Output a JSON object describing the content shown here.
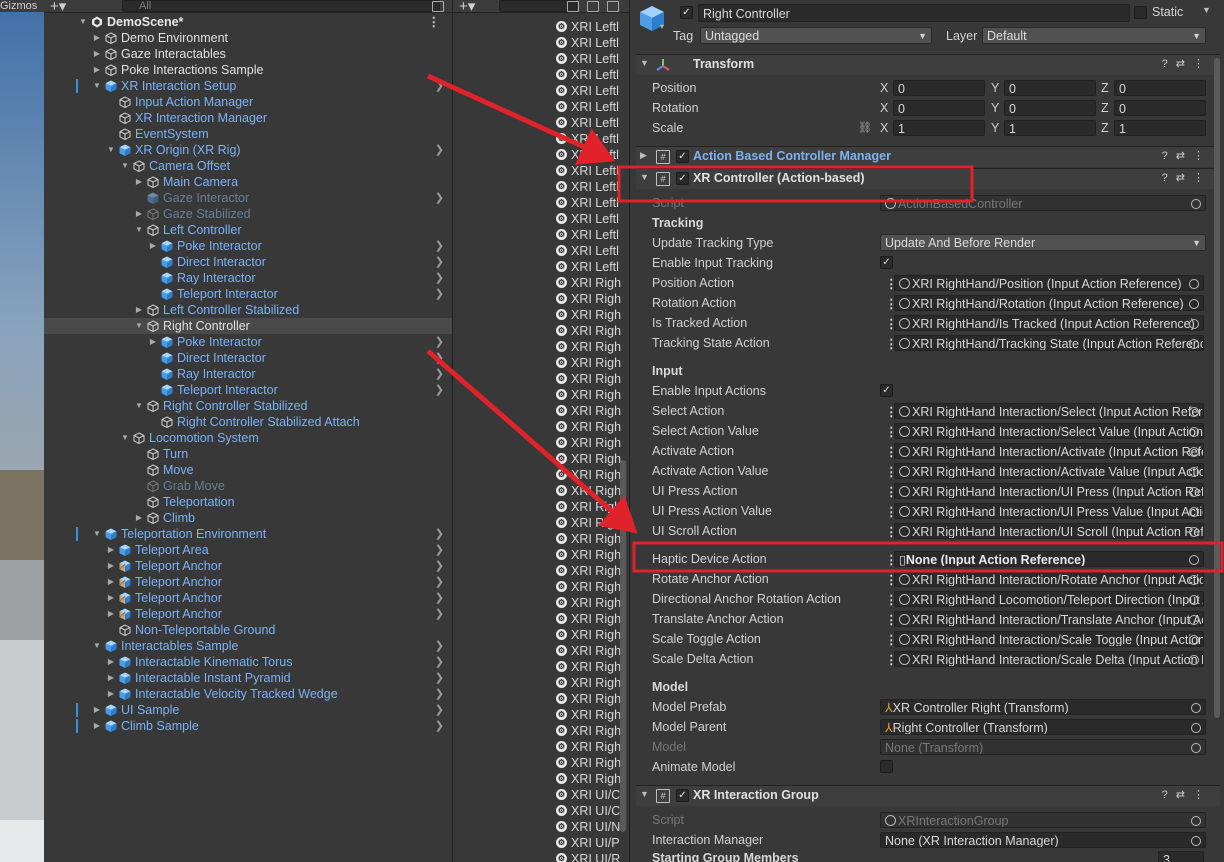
{
  "scene": {
    "gizmos_label": "Gizmos"
  },
  "hierarchy": {
    "search_placeholder": "All",
    "items": [
      {
        "label": "DemoScene*",
        "indent": 0,
        "style": "bold",
        "arrow": "down",
        "icon": "unity",
        "kebab": true
      },
      {
        "label": "Demo Environment",
        "indent": 1,
        "style": "white",
        "arrow": "right",
        "icon": "cube"
      },
      {
        "label": "Gaze Interactables",
        "indent": 1,
        "style": "white",
        "arrow": "right",
        "icon": "cube"
      },
      {
        "label": "Poke Interactions Sample",
        "indent": 1,
        "style": "white",
        "arrow": "right",
        "icon": "cube"
      },
      {
        "label": "XR Interaction Setup",
        "indent": 1,
        "style": "blue",
        "arrow": "down",
        "icon": "prefab",
        "chev": true,
        "mark": true
      },
      {
        "label": "Input Action Manager",
        "indent": 2,
        "style": "blue",
        "arrow": "none",
        "icon": "cube"
      },
      {
        "label": "XR Interaction Manager",
        "indent": 2,
        "style": "blue",
        "arrow": "none",
        "icon": "cube"
      },
      {
        "label": "EventSystem",
        "indent": 2,
        "style": "blue",
        "arrow": "none",
        "icon": "cube"
      },
      {
        "label": "XR Origin (XR Rig)",
        "indent": 2,
        "style": "blue",
        "arrow": "down",
        "icon": "prefab",
        "chev": true
      },
      {
        "label": "Camera Offset",
        "indent": 3,
        "style": "blue",
        "arrow": "down",
        "icon": "cube"
      },
      {
        "label": "Main Camera",
        "indent": 4,
        "style": "blue",
        "arrow": "right",
        "icon": "cube"
      },
      {
        "label": "Gaze Interactor",
        "indent": 4,
        "style": "dim",
        "arrow": "none",
        "icon": "prefab-dim",
        "chev": true
      },
      {
        "label": "Gaze Stabilized",
        "indent": 4,
        "style": "dim",
        "arrow": "right",
        "icon": "cube-dim"
      },
      {
        "label": "Left Controller",
        "indent": 4,
        "style": "blue",
        "arrow": "down",
        "icon": "cube"
      },
      {
        "label": "Poke Interactor",
        "indent": 5,
        "style": "blue",
        "arrow": "right",
        "icon": "prefab",
        "chev": true
      },
      {
        "label": "Direct Interactor",
        "indent": 5,
        "style": "blue",
        "arrow": "none",
        "icon": "prefab",
        "chev": true
      },
      {
        "label": "Ray Interactor",
        "indent": 5,
        "style": "blue",
        "arrow": "none",
        "icon": "prefab",
        "chev": true
      },
      {
        "label": "Teleport Interactor",
        "indent": 5,
        "style": "blue",
        "arrow": "none",
        "icon": "prefab",
        "chev": true
      },
      {
        "label": "Left Controller Stabilized",
        "indent": 4,
        "style": "blue",
        "arrow": "right",
        "icon": "cube"
      },
      {
        "label": "Right Controller",
        "indent": 4,
        "style": "white",
        "arrow": "down",
        "icon": "cube",
        "selected": true
      },
      {
        "label": "Poke Interactor",
        "indent": 5,
        "style": "blue",
        "arrow": "right",
        "icon": "prefab",
        "chev": true
      },
      {
        "label": "Direct Interactor",
        "indent": 5,
        "style": "blue",
        "arrow": "none",
        "icon": "prefab",
        "chev": true
      },
      {
        "label": "Ray Interactor",
        "indent": 5,
        "style": "blue",
        "arrow": "none",
        "icon": "prefab",
        "chev": true
      },
      {
        "label": "Teleport Interactor",
        "indent": 5,
        "style": "blue",
        "arrow": "none",
        "icon": "prefab",
        "chev": true
      },
      {
        "label": "Right Controller Stabilized",
        "indent": 4,
        "style": "blue",
        "arrow": "down",
        "icon": "cube"
      },
      {
        "label": "Right Controller Stabilized Attach",
        "indent": 5,
        "style": "blue",
        "arrow": "none",
        "icon": "cube"
      },
      {
        "label": "Locomotion System",
        "indent": 3,
        "style": "blue",
        "arrow": "down",
        "icon": "cube"
      },
      {
        "label": "Turn",
        "indent": 4,
        "style": "blue",
        "arrow": "none",
        "icon": "cube"
      },
      {
        "label": "Move",
        "indent": 4,
        "style": "blue",
        "arrow": "none",
        "icon": "cube"
      },
      {
        "label": "Grab Move",
        "indent": 4,
        "style": "dim",
        "arrow": "none",
        "icon": "cube-dim"
      },
      {
        "label": "Teleportation",
        "indent": 4,
        "style": "blue",
        "arrow": "none",
        "icon": "cube"
      },
      {
        "label": "Climb",
        "indent": 4,
        "style": "blue",
        "arrow": "right",
        "icon": "cube"
      },
      {
        "label": "Teleportation Environment",
        "indent": 1,
        "style": "blue",
        "arrow": "down",
        "icon": "prefab",
        "chev": true,
        "mark": true
      },
      {
        "label": "Teleport Area",
        "indent": 2,
        "style": "blue",
        "arrow": "right",
        "icon": "prefab",
        "chev": true
      },
      {
        "label": "Teleport Anchor",
        "indent": 2,
        "style": "blue",
        "arrow": "right",
        "icon": "prefab-stripe",
        "chev": true
      },
      {
        "label": "Teleport Anchor",
        "indent": 2,
        "style": "blue",
        "arrow": "right",
        "icon": "prefab-stripe",
        "chev": true
      },
      {
        "label": "Teleport Anchor",
        "indent": 2,
        "style": "blue",
        "arrow": "right",
        "icon": "prefab-stripe",
        "chev": true
      },
      {
        "label": "Teleport Anchor",
        "indent": 2,
        "style": "blue",
        "arrow": "right",
        "icon": "prefab-stripe",
        "chev": true
      },
      {
        "label": "Non-Teleportable Ground",
        "indent": 2,
        "style": "blue",
        "arrow": "none",
        "icon": "cube"
      },
      {
        "label": "Interactables Sample",
        "indent": 1,
        "style": "blue",
        "arrow": "down",
        "icon": "prefab",
        "chev": true
      },
      {
        "label": "Interactable Kinematic Torus",
        "indent": 2,
        "style": "blue",
        "arrow": "right",
        "icon": "prefab",
        "chev": true
      },
      {
        "label": "Interactable Instant Pyramid",
        "indent": 2,
        "style": "blue",
        "arrow": "right",
        "icon": "prefab",
        "chev": true
      },
      {
        "label": "Interactable Velocity Tracked Wedge",
        "indent": 2,
        "style": "blue",
        "arrow": "right",
        "icon": "prefab",
        "chev": true
      },
      {
        "label": "UI Sample",
        "indent": 1,
        "style": "blue",
        "arrow": "right",
        "icon": "prefab",
        "chev": true,
        "mark": true
      },
      {
        "label": "Climb Sample",
        "indent": 1,
        "style": "blue",
        "arrow": "right",
        "icon": "prefab",
        "chev": true,
        "mark": true
      }
    ]
  },
  "project": {
    "items": [
      "XRI Leftl",
      "XRI Leftl",
      "XRI Leftl",
      "XRI Leftl",
      "XRI Leftl",
      "XRI Leftl",
      "XRI Leftl",
      "XRI Leftl",
      "XRI Leftl",
      "XRI Leftl",
      "XRI Leftl",
      "XRI Leftl",
      "XRI Leftl",
      "XRI Leftl",
      "XRI Leftl",
      "XRI Leftl",
      "XRI Righ",
      "XRI Righ",
      "XRI Righ",
      "XRI Righ",
      "XRI Righ",
      "XRI Righ",
      "XRI Righ",
      "XRI Righ",
      "XRI Righ",
      "XRI Righ",
      "XRI Righ",
      "XRI Righ",
      "XRI Righ",
      "XRI Righ",
      "XRI Righ",
      "XRI Righ",
      "XRI Righ",
      "XRI Righ",
      "XRI Righ",
      "XRI Righ",
      "XRI Righ",
      "XRI Righ",
      "XRI Righ",
      "XRI Righ",
      "XRI Righ",
      "XRI Righ",
      "XRI Righ",
      "XRI Righ",
      "XRI Righ",
      "XRI Righ",
      "XRI Righ",
      "XRI Righ",
      "XRI UI/C",
      "XRI UI/C",
      "XRI UI/N",
      "XRI UI/P",
      "XRI UI/R"
    ]
  },
  "inspector": {
    "object_name": "Right Controller",
    "static_label": "Static",
    "tag_label": "Tag",
    "tag_value": "Untagged",
    "layer_label": "Layer",
    "layer_value": "Default",
    "transform": {
      "title": "Transform",
      "position_label": "Position",
      "rotation_label": "Rotation",
      "scale_label": "Scale",
      "position": [
        "0",
        "0",
        "0"
      ],
      "rotation": [
        "0",
        "0",
        "0"
      ],
      "scale": [
        "1",
        "1",
        "1"
      ],
      "axes": [
        "X",
        "Y",
        "Z"
      ]
    },
    "abcm_title": "Action Based Controller Manager",
    "xrc": {
      "title": "XR Controller (Action-based)",
      "script_label": "Script",
      "script_value": "ActionBasedController",
      "tracking_header": "Tracking",
      "update_tracking_type_label": "Update Tracking Type",
      "update_tracking_type_value": "Update And Before Render",
      "enable_input_tracking_label": "Enable Input Tracking",
      "tracking_rows": [
        {
          "label": "Position Action",
          "value": "XRI RightHand/Position (Input Action Reference)"
        },
        {
          "label": "Rotation Action",
          "value": "XRI RightHand/Rotation (Input Action Reference)"
        },
        {
          "label": "Is Tracked Action",
          "value": "XRI RightHand/Is Tracked (Input Action Reference)"
        },
        {
          "label": "Tracking State Action",
          "value": "XRI RightHand/Tracking State (Input Action Reference)"
        }
      ],
      "input_header": "Input",
      "enable_input_actions_label": "Enable Input Actions",
      "input_rows": [
        {
          "label": "Select Action",
          "value": "XRI RightHand Interaction/Select (Input Action Reference)"
        },
        {
          "label": "Select Action Value",
          "value": "XRI RightHand Interaction/Select Value (Input Action Reference)"
        },
        {
          "label": "Activate Action",
          "value": "XRI RightHand Interaction/Activate (Input Action Reference)"
        },
        {
          "label": "Activate Action Value",
          "value": "XRI RightHand Interaction/Activate Value (Input Action Reference)"
        },
        {
          "label": "UI Press Action",
          "value": "XRI RightHand Interaction/UI Press (Input Action Reference)"
        },
        {
          "label": "UI Press Action Value",
          "value": "XRI RightHand Interaction/UI Press Value (Input Action Reference)"
        },
        {
          "label": "UI Scroll Action",
          "value": "XRI RightHand Interaction/UI Scroll (Input Action Reference)"
        }
      ],
      "haptic_label": "Haptic Device Action",
      "haptic_value": "None (Input Action Reference)",
      "more_rows": [
        {
          "label": "Rotate Anchor Action",
          "value": "XRI RightHand Interaction/Rotate Anchor (Input Action Reference)"
        },
        {
          "label": "Directional Anchor Rotation Action",
          "value": "XRI RightHand Locomotion/Teleport Direction (Input Action Reference)"
        },
        {
          "label": "Translate Anchor Action",
          "value": "XRI RightHand Interaction/Translate Anchor (Input Action Reference)"
        },
        {
          "label": "Scale Toggle Action",
          "value": "XRI RightHand Interaction/Scale Toggle (Input Action Reference)"
        },
        {
          "label": "Scale Delta Action",
          "value": "XRI RightHand Interaction/Scale Delta (Input Action Reference)"
        }
      ],
      "model_header": "Model",
      "model_prefab_label": "Model Prefab",
      "model_prefab_value": "XR Controller Right (Transform)",
      "model_parent_label": "Model Parent",
      "model_parent_value": "Right Controller (Transform)",
      "model_label": "Model",
      "model_value": "None (Transform)",
      "animate_model_label": "Animate Model"
    },
    "xrig": {
      "title": "XR Interaction Group",
      "script_label": "Script",
      "script_value": "XRInteractionGroup",
      "interaction_manager_label": "Interaction Manager",
      "interaction_manager_value": "None (XR Interaction Manager)",
      "starting_group_members_label": "Starting Group Members",
      "starting_group_members_count": "3"
    }
  },
  "colors": {
    "annotation_red": "#e0222a",
    "prefab_blue": "#7cb2f2",
    "background": "#383838"
  }
}
